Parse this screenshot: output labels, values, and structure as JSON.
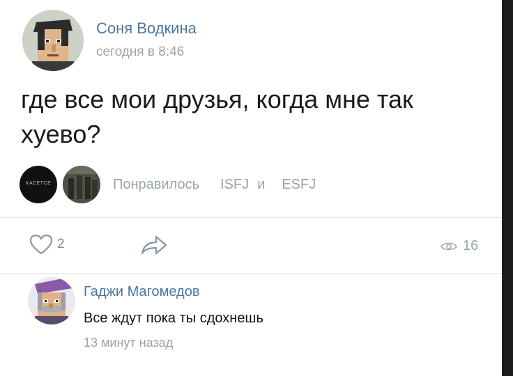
{
  "post": {
    "author": "Соня Водкина",
    "time": "сегодня в 8:46",
    "text": "где все мои друзья, когда мне так хуево?",
    "liked_by_label": "Понравилось",
    "liked_by_first": "ISFJ",
    "liked_by_conj": "и",
    "liked_by_second": "ESFJ",
    "liker_1_caption": "KACETCE",
    "like_count": "2",
    "views_count": "16"
  },
  "comment": {
    "author": "Гаджи Магомедов",
    "text": "Все ждут пока ты сдохнешь",
    "time": "13 минут назад"
  },
  "colors": {
    "link_blue": "#4a76a8",
    "muted_gray": "#9aa3ad",
    "text_dark": "#1a1a1a"
  }
}
